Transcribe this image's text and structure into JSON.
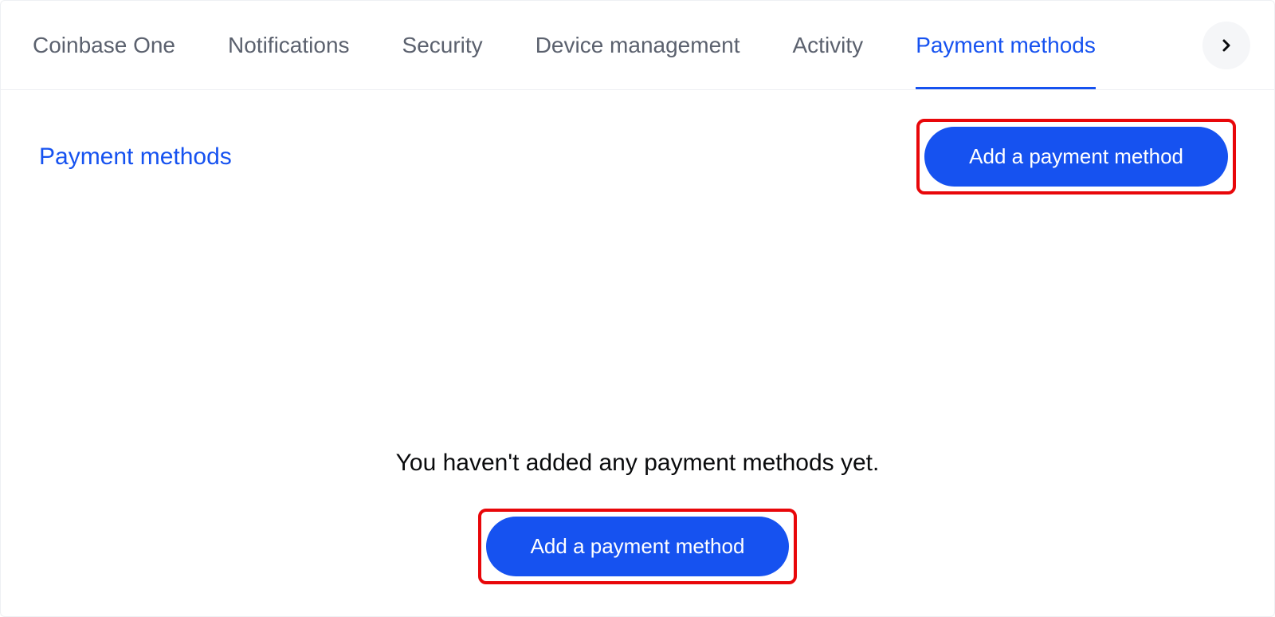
{
  "tabs": {
    "items": [
      {
        "label": "Coinbase One",
        "active": false
      },
      {
        "label": "Notifications",
        "active": false
      },
      {
        "label": "Security",
        "active": false
      },
      {
        "label": "Device management",
        "active": false
      },
      {
        "label": "Activity",
        "active": false
      },
      {
        "label": "Payment methods",
        "active": true
      }
    ]
  },
  "header": {
    "section_title": "Payment methods",
    "add_button_label": "Add a payment method"
  },
  "empty_state": {
    "message": "You haven't added any payment methods yet.",
    "add_button_label": "Add a payment method"
  },
  "colors": {
    "brand_blue": "#1652f0",
    "highlight_red": "#e8070a",
    "tab_inactive": "#5b616e"
  }
}
